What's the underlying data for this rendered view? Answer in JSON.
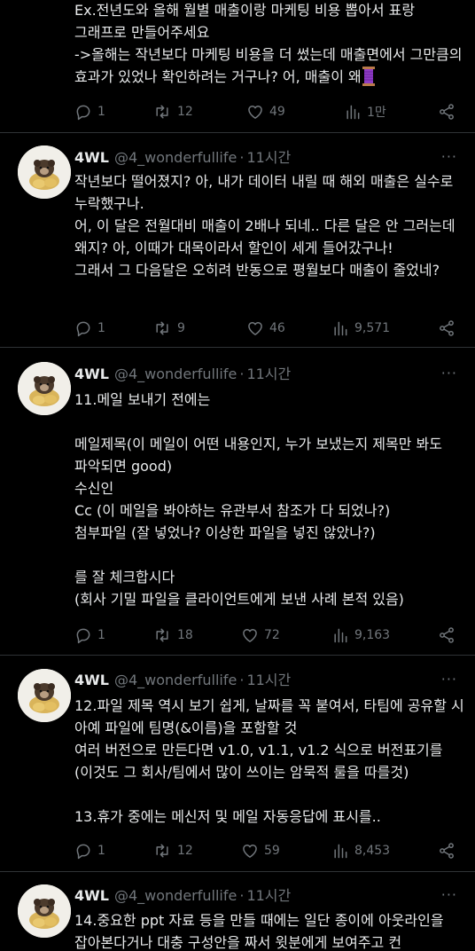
{
  "colors": {
    "background": "#000000",
    "text": "#e7e9ea",
    "muted": "#71767b",
    "divider": "#2f3336"
  },
  "icons": {
    "reply": "reply-icon",
    "retweet": "retweet-icon",
    "like": "like-icon",
    "views": "views-icon",
    "share": "share-icon",
    "more": "more-icon",
    "emoji": "thread-spool-emoji"
  },
  "tweets": [
    {
      "body": "Ex.전년도와 올해 월별 매출이랑 마케팅 비용 뽑아서 표랑 그래프로 만들어주세요\n->올해는 작년보다 마케팅 비용을 더 썼는데 매출면에서 그만큼의 효과가 있었나 확인하려는 거구나? 어, 매출이 왜",
      "replies": "1",
      "retweets": "12",
      "likes": "49",
      "views": "1만"
    },
    {
      "name": "4WL",
      "handle": "@4_wonderfullife",
      "dot": "·",
      "time": "11시간",
      "body": "작년보다 떨어졌지? 아, 내가 데이터 내릴 때 해외 매출은 실수로 누락했구나.\n어, 이 달은 전월대비 매출이 2배나 되네.. 다른 달은 안 그러는데 왜지? 아, 이때가 대목이라서 할인이 세게 들어갔구나!\n그래서 그 다음달은 오히려 반동으로 평월보다 매출이 줄었네?",
      "replies": "1",
      "retweets": "9",
      "likes": "46",
      "views": "9,571"
    },
    {
      "name": "4WL",
      "handle": "@4_wonderfullife",
      "dot": "·",
      "time": "11시간",
      "body": "11.메일 보내기 전에는\n\n메일제목(이 메일이 어떤 내용인지, 누가 보냈는지 제목만 봐도 파악되면 good)\n수신인\nCc (이 메일을 봐야하는 유관부서 참조가 다 되었나?)\n첨부파일 (잘 넣었나? 이상한 파일을 넣진 않았나?)\n\n를 잘 체크합시다\n(회사 기밀 파일을 클라이언트에게 보낸 사례 본적 있음)",
      "replies": "1",
      "retweets": "18",
      "likes": "72",
      "views": "9,163"
    },
    {
      "name": "4WL",
      "handle": "@4_wonderfullife",
      "dot": "·",
      "time": "11시간",
      "body": "12.파일 제목 역시 보기 쉽게, 날짜를 꼭 붙여서, 타팀에 공유할 시 아예 파일에 팀명(&이름)을 포함할 것\n여러 버전으로 만든다면 v1.0, v1.1, v1.2 식으로 버전표기를 (이것도 그 회사/팀에서 많이 쓰이는 암묵적 룰을 따를것)\n\n13.휴가 중에는 메신저 및 메일 자동응답에 표시를..",
      "replies": "1",
      "retweets": "12",
      "likes": "59",
      "views": "8,453"
    },
    {
      "name": "4WL",
      "handle": "@4_wonderfullife",
      "dot": "·",
      "time": "11시간",
      "body": "14.중요한 ppt 자료 등을 만들 때에는 일단 종이에 아웃라인을 잡아본다거나 대충 구성안을 짜서 윗분에게 보여주고 컨"
    }
  ]
}
